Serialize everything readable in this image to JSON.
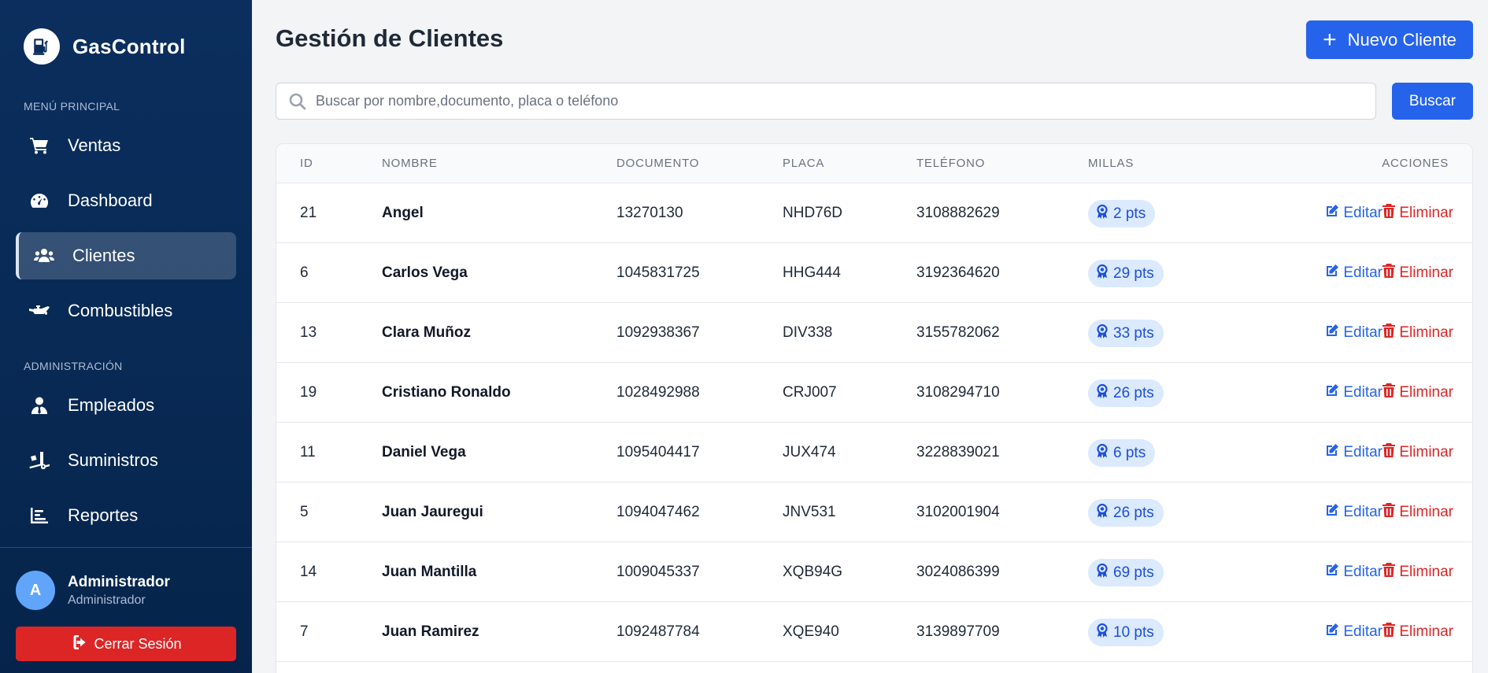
{
  "app": {
    "name": "GasControl"
  },
  "sidebar": {
    "section_main": "MENÚ PRINCIPAL",
    "section_admin": "ADMINISTRACIÓN",
    "main_items": [
      {
        "label": "Ventas",
        "icon": "cart-icon"
      },
      {
        "label": "Dashboard",
        "icon": "gauge-icon"
      },
      {
        "label": "Clientes",
        "icon": "users-icon",
        "active": true
      },
      {
        "label": "Combustibles",
        "icon": "oil-can-icon"
      }
    ],
    "admin_items": [
      {
        "label": "Empleados",
        "icon": "user-tie-icon"
      },
      {
        "label": "Suministros",
        "icon": "truck-loading-icon"
      },
      {
        "label": "Reportes",
        "icon": "chart-bar-icon"
      }
    ],
    "user": {
      "initial": "A",
      "name": "Administrador",
      "role": "Administrador"
    },
    "logout_label": "Cerrar Sesión"
  },
  "header": {
    "title": "Gestión de Clientes",
    "new_button": "Nuevo Cliente"
  },
  "search": {
    "placeholder": "Buscar por nombre,documento, placa o teléfono",
    "value": "",
    "button": "Buscar"
  },
  "table": {
    "columns": [
      "ID",
      "NOMBRE",
      "DOCUMENTO",
      "PLACA",
      "TELÉFONO",
      "MILLAS",
      "ACCIONES"
    ],
    "edit_label": "Editar",
    "delete_label": "Eliminar",
    "rows": [
      {
        "id": "21",
        "name": "Angel",
        "document": "13270130",
        "plate": "NHD76D",
        "phone": "3108882629",
        "miles": "2 pts"
      },
      {
        "id": "6",
        "name": "Carlos Vega",
        "document": "1045831725",
        "plate": "HHG444",
        "phone": "3192364620",
        "miles": "29 pts"
      },
      {
        "id": "13",
        "name": "Clara Muñoz",
        "document": "1092938367",
        "plate": "DIV338",
        "phone": "3155782062",
        "miles": "33 pts"
      },
      {
        "id": "19",
        "name": "Cristiano Ronaldo",
        "document": "1028492988",
        "plate": "CRJ007",
        "phone": "3108294710",
        "miles": "26 pts"
      },
      {
        "id": "11",
        "name": "Daniel Vega",
        "document": "1095404417",
        "plate": "JUX474",
        "phone": "3228839021",
        "miles": "6 pts"
      },
      {
        "id": "5",
        "name": "Juan Jauregui",
        "document": "1094047462",
        "plate": "JNV531",
        "phone": "3102001904",
        "miles": "26 pts"
      },
      {
        "id": "14",
        "name": "Juan Mantilla",
        "document": "1009045337",
        "plate": "XQB94G",
        "phone": "3024086399",
        "miles": "69 pts"
      },
      {
        "id": "7",
        "name": "Juan Ramirez",
        "document": "1092487784",
        "plate": "XQE940",
        "phone": "3139897709",
        "miles": "10 pts"
      }
    ]
  },
  "colors": {
    "primary": "#2563eb",
    "danger": "#dc2626",
    "sidebar": "#0b2e5e",
    "badge_bg": "#dbeafe"
  }
}
